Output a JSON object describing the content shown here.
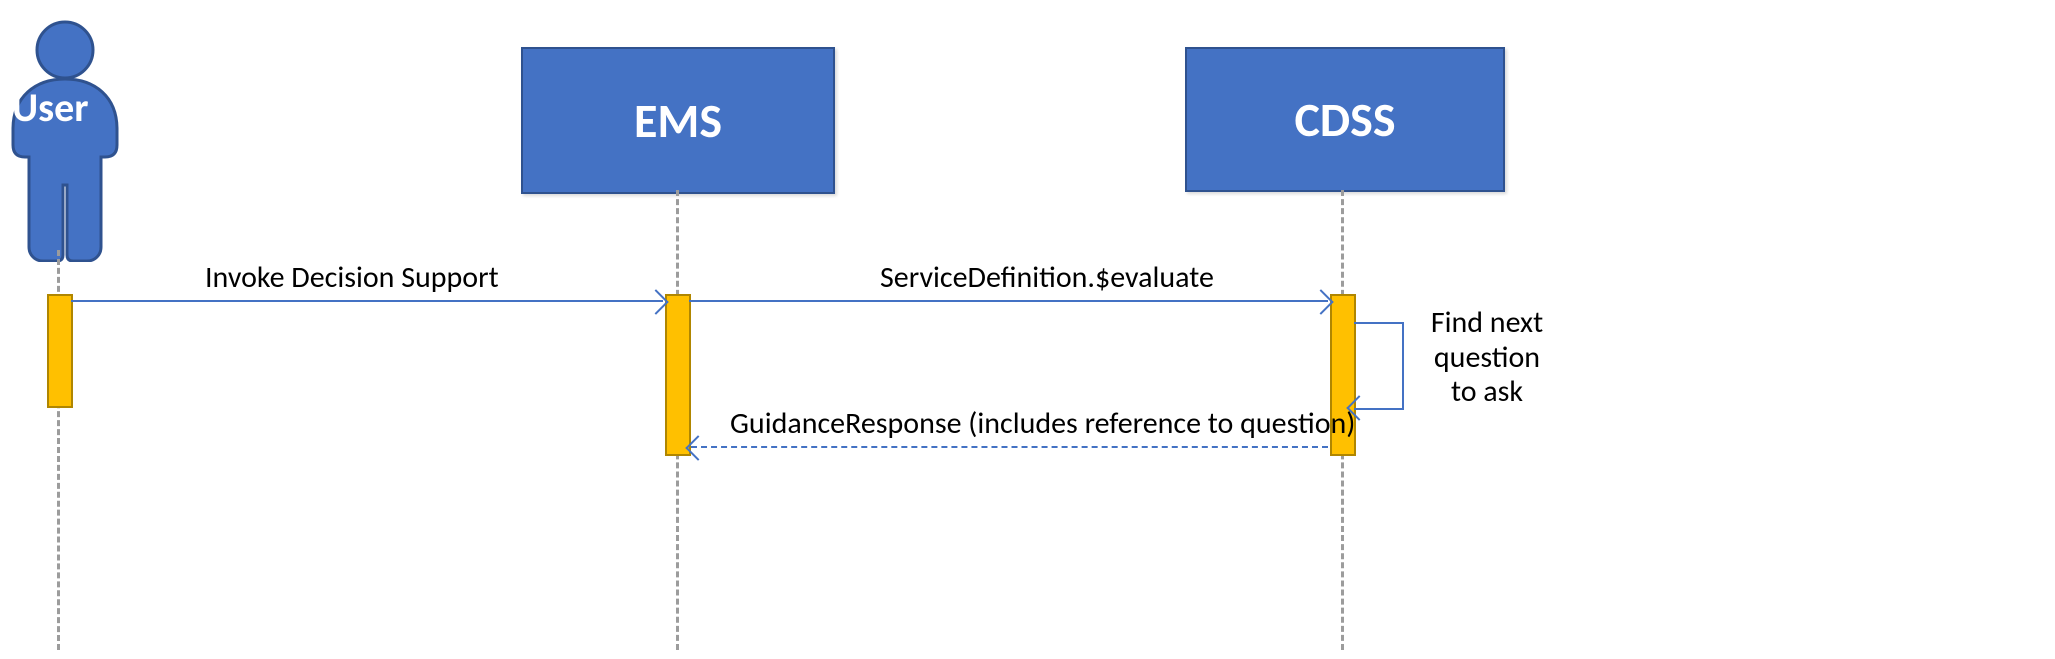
{
  "participants": {
    "user": {
      "label": "User"
    },
    "ems": {
      "label": "EMS"
    },
    "cdss": {
      "label": "CDSS"
    }
  },
  "messages": {
    "invoke": {
      "label": "Invoke Decision Support"
    },
    "evaluate": {
      "label": "ServiceDefinition.$evaluate"
    },
    "response": {
      "label": "GuidanceResponse (includes reference to question)"
    },
    "selfcall": {
      "label": "Find next question to ask"
    },
    "selfcall_l1": "Find next",
    "selfcall_l2": "question",
    "selfcall_l3": "to ask"
  },
  "colors": {
    "box_fill": "#4472C4",
    "box_border": "#2F528F",
    "activation_fill": "#FFC000",
    "activation_border": "#B08600",
    "lifeline": "#9c9c9c",
    "arrow": "#4472C4"
  }
}
